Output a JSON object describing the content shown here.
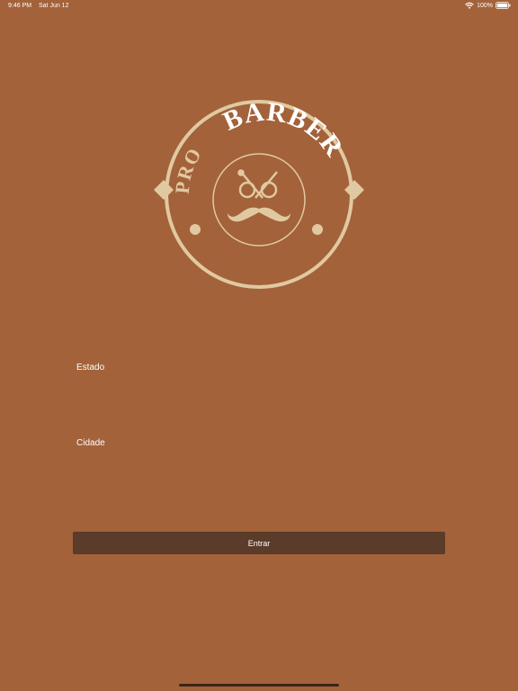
{
  "status_bar": {
    "time": "9:46 PM",
    "date": "Sat Jun 12",
    "battery": "100%"
  },
  "logo": {
    "text_pro": "PRO",
    "text_barber": "BARBER",
    "color": "#e0c9a0"
  },
  "form": {
    "state_label": "Estado",
    "state_value": "",
    "city_label": "Cidade",
    "city_value": "",
    "submit_label": "Entrar"
  },
  "colors": {
    "background": "#a3623a",
    "button": "#5b3b2a",
    "accent": "#e0c9a0"
  },
  "icons": {
    "wifi": "wifi-icon",
    "battery": "battery-icon",
    "scissors": "scissors-icon",
    "mustache": "mustache-icon"
  }
}
